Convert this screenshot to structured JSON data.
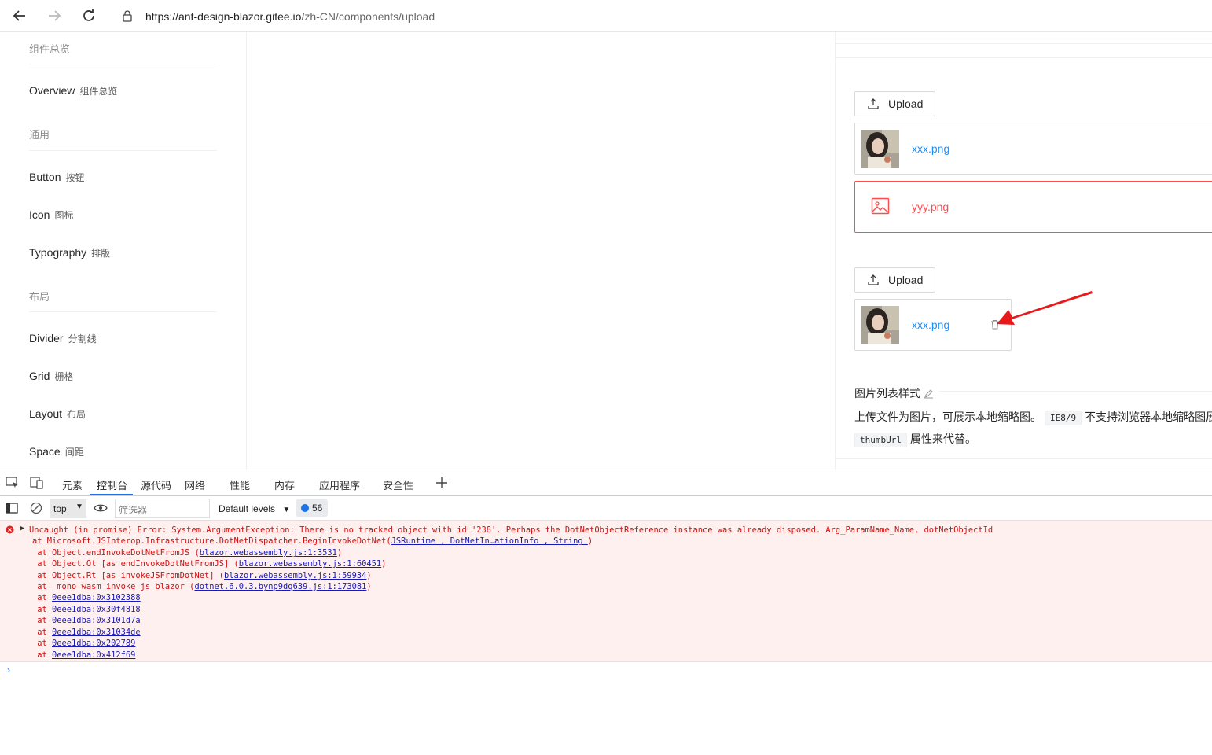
{
  "browser": {
    "url_host": "https://ant-design-blazor.gitee.io",
    "url_path": "/zh-CN/components/upload"
  },
  "sidebar": {
    "overview_group": "组件总览",
    "overview": {
      "label": "Overview",
      "cn": "组件总览"
    },
    "general_group": "通用",
    "button": {
      "label": "Button",
      "cn": "按钮"
    },
    "icon": {
      "label": "Icon",
      "cn": "图标"
    },
    "typography": {
      "label": "Typography",
      "cn": "排版"
    },
    "layout_group": "布局",
    "divider": {
      "label": "Divider",
      "cn": "分割线"
    },
    "grid": {
      "label": "Grid",
      "cn": "栅格"
    },
    "layout": {
      "label": "Layout",
      "cn": "布局"
    },
    "space": {
      "label": "Space",
      "cn": "间距"
    }
  },
  "demo": {
    "upload_label": "Upload",
    "file1": "xxx.png",
    "file2": "yyy.png",
    "file3": "xxx.png",
    "section_title": "图片列表样式",
    "desc_line1_a": "上传文件为图片，可展示本地缩略图。",
    "desc_code1": "IE8/9",
    "desc_line1_b": "不支持浏览器本地缩略图展",
    "desc_code2": "thumbUrl",
    "desc_line2": "属性来代替。"
  },
  "devtools": {
    "tabs": [
      "元素",
      "控制台",
      "源代码",
      "网络",
      "性能",
      "内存",
      "应用程序",
      "安全性"
    ],
    "context": "top",
    "filter_placeholder": "筛选器",
    "levels": "Default levels",
    "message_count": "56",
    "error": {
      "line1": "Uncaught (in promise) Error: System.ArgumentException: There is no tracked object with id '238'. Perhaps the DotNetObjectReference instance was already disposed. Arg_ParamName_Name, dotNetObjectId",
      "line2_prefix": "at Microsoft.JSInterop.Infrastructure.DotNetDispatcher.BeginInvokeDotNet(",
      "line2_link": "JSRuntime , DotNetIn…ationInfo , String ",
      "line2_suffix": ")",
      "stack": [
        {
          "prefix": " at Object.endInvokeDotNetFromJS (",
          "link": "blazor.webassembly.js:1:3531",
          "suffix": ")"
        },
        {
          "prefix": " at Object.Ot [as endInvokeDotNetFromJS] (",
          "link": "blazor.webassembly.js:1:60451",
          "suffix": ")"
        },
        {
          "prefix": " at Object.Rt [as invokeJSFromDotNet] (",
          "link": "blazor.webassembly.js:1:59934",
          "suffix": ")"
        },
        {
          "prefix": " at _mono_wasm_invoke_js_blazor (",
          "link": "dotnet.6.0.3.bynp9dq639.js:1:173081",
          "suffix": ")"
        },
        {
          "prefix": " at ",
          "link": "0eee1dba:0x3102388",
          "suffix": ""
        },
        {
          "prefix": " at ",
          "link": "0eee1dba:0x30f4818",
          "suffix": ""
        },
        {
          "prefix": " at ",
          "link": "0eee1dba:0x3101d7a",
          "suffix": ""
        },
        {
          "prefix": " at ",
          "link": "0eee1dba:0x31034de",
          "suffix": ""
        },
        {
          "prefix": " at ",
          "link": "0eee1dba:0x202789",
          "suffix": ""
        },
        {
          "prefix": " at ",
          "link": "0eee1dba:0x412f69",
          "suffix": ""
        }
      ]
    }
  }
}
